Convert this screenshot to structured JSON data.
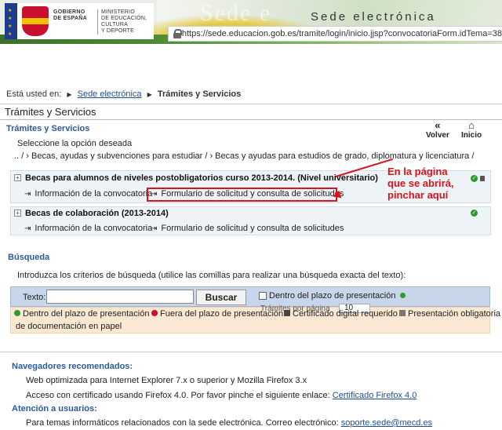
{
  "header": {
    "gov_lines": [
      "GOBIERNO",
      "DE ESPAÑA"
    ],
    "ministry_lines": [
      "MINISTERIO",
      "DE EDUCACIÓN, CULTURA",
      "Y DEPORTE"
    ],
    "site_title": "Sede electrónica",
    "watermark": "Sede e",
    "url": "https://sede.educacion.gob.es/tramite/login/inicio.jjsp?convocatoriaForm.idTema=38"
  },
  "breadcrumb": {
    "prefix": "Está usted en:",
    "home": "Sede electrónica",
    "current": "Trámites y Servicios"
  },
  "page_title": "Trámites y Servicios",
  "main": {
    "section_title": "Trámites y Servicios",
    "prompt": "Seleccione la opción deseada",
    "path": ".. /  ›  Becas, ayudas y subvenciones para estudiar /  ›  Becas y ayudas para estudios de grado, diplomatura y licenciatura /",
    "back_label": "Volver",
    "home_label": "Inicio"
  },
  "cards": [
    {
      "title": "Becas para alumnos de niveles postobligatorios curso 2013-2014. (Nivel universitario)",
      "link_info": "Información de la convocatoria",
      "link_form": "Formulario de solicitud y consulta de solicitudes"
    },
    {
      "title": "Becas de colaboración (2013-2014)",
      "link_info": "Información de la convocatoria",
      "link_form": "Formulario de solicitud y consulta de solicitudes"
    }
  ],
  "annotation": {
    "line1": "En la página",
    "line2": "que se abrirá,",
    "line3": "pinchar aquí"
  },
  "search": {
    "title": "Búsqueda",
    "hint": "Introduzca los criterios de búsqueda (utilice las comillas para realizar una búsqueda exacta del texto):",
    "text_label": "Texto:",
    "text_value": "",
    "button": "Buscar",
    "checkbox_label": "Dentro del plazo de presentación",
    "overlap_text": "Trámites por página",
    "per_page": "10"
  },
  "legend": {
    "in_deadline": "Dentro del plazo de presentación",
    "out_deadline": "Fuera del plazo de presentación",
    "digital_cert": "Certificado digital requerido",
    "paper_line1": "Presentación obligatoria",
    "paper_line2": "de documentación en papel"
  },
  "footer": {
    "browsers_title": "Navegadores recomendados:",
    "browsers_line": "Web optimizada para Internet Explorer 7.x o superior y Mozilla Firefox 3.x",
    "cert_line": "Acceso con certificado usando Firefox 4.0. Por favor pinche el siguiente enlace:",
    "cert_link": "Certificado Firefox 4.0",
    "support_title": "Atención a usuarios:",
    "support_line": "Para temas informáticos relacionados con la sede electrónica. Correo electrónico:",
    "support_email": "soporte.sede@mecd.es"
  },
  "colors": {
    "link_blue": "#1d4f91",
    "section_blue": "#2a5a9c",
    "annotation_red": "#d9141b",
    "status_green": "#2f9b2f"
  }
}
